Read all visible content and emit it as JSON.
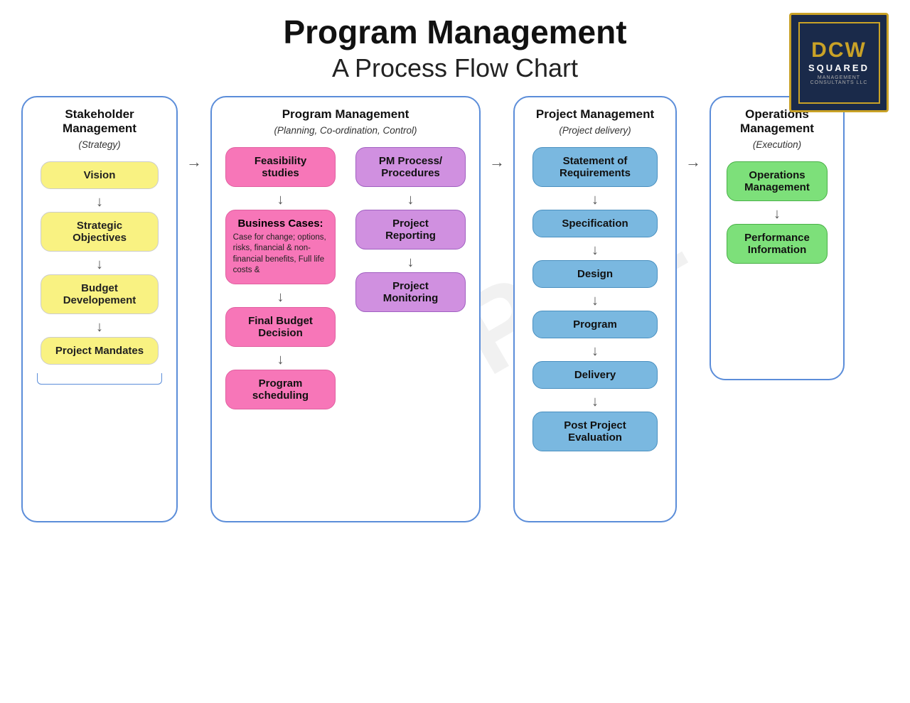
{
  "page": {
    "title": "Program Management",
    "subtitle": "A Process Flow Chart",
    "watermark": "SAMPLE"
  },
  "logo": {
    "line1": "DCW",
    "line2": "SQUARED",
    "line3": "MANAGEMENT CONSULTANTS LLC"
  },
  "columns": [
    {
      "id": "stakeholder",
      "header": "Stakeholder Management",
      "subheader": "(Strategy)",
      "nodes": [
        {
          "id": "vision",
          "label": "Vision",
          "style": "yellow"
        },
        {
          "id": "strategic-objectives",
          "label": "Strategic Objectives",
          "style": "yellow"
        },
        {
          "id": "budget-development",
          "label": "Budget Developement",
          "style": "yellow"
        },
        {
          "id": "project-mandates",
          "label": "Project Mandates",
          "style": "yellow"
        }
      ]
    },
    {
      "id": "program",
      "header": "Program Management",
      "subheader": "(Planning, Co-ordination, Control)",
      "left_nodes": [
        {
          "id": "feasibility-studies",
          "label": "Feasibility studies",
          "style": "pink"
        },
        {
          "id": "business-cases",
          "label": "Business Cases:",
          "description": "Case for change; options, risks, financial & non-financial benefits, Full life costs &",
          "style": "pink"
        },
        {
          "id": "final-budget-decision",
          "label": "Final Budget Decision",
          "style": "pink"
        },
        {
          "id": "program-scheduling",
          "label": "Program scheduling",
          "style": "pink"
        }
      ],
      "right_nodes": [
        {
          "id": "pm-process",
          "label": "PM Process/ Procedures",
          "style": "purple"
        },
        {
          "id": "project-reporting",
          "label": "Project Reporting",
          "style": "purple"
        },
        {
          "id": "project-monitoring",
          "label": "Project Monitoring",
          "style": "purple"
        }
      ]
    },
    {
      "id": "project",
      "header": "Project Management",
      "subheader": "(Project delivery)",
      "nodes": [
        {
          "id": "statement-of-requirements",
          "label": "Statement of Requirements",
          "style": "blue"
        },
        {
          "id": "specification",
          "label": "Specification",
          "style": "blue"
        },
        {
          "id": "design",
          "label": "Design",
          "style": "blue"
        },
        {
          "id": "program",
          "label": "Program",
          "style": "blue"
        },
        {
          "id": "delivery",
          "label": "Delivery",
          "style": "blue"
        },
        {
          "id": "post-project-evaluation",
          "label": "Post Project Evaluation",
          "style": "blue"
        }
      ]
    },
    {
      "id": "operations",
      "header": "Operations Management",
      "subheader": "(Execution)",
      "nodes": [
        {
          "id": "operations-management",
          "label": "Operations Management",
          "style": "green"
        },
        {
          "id": "performance-information",
          "label": "Performance Information",
          "style": "green"
        }
      ]
    }
  ]
}
